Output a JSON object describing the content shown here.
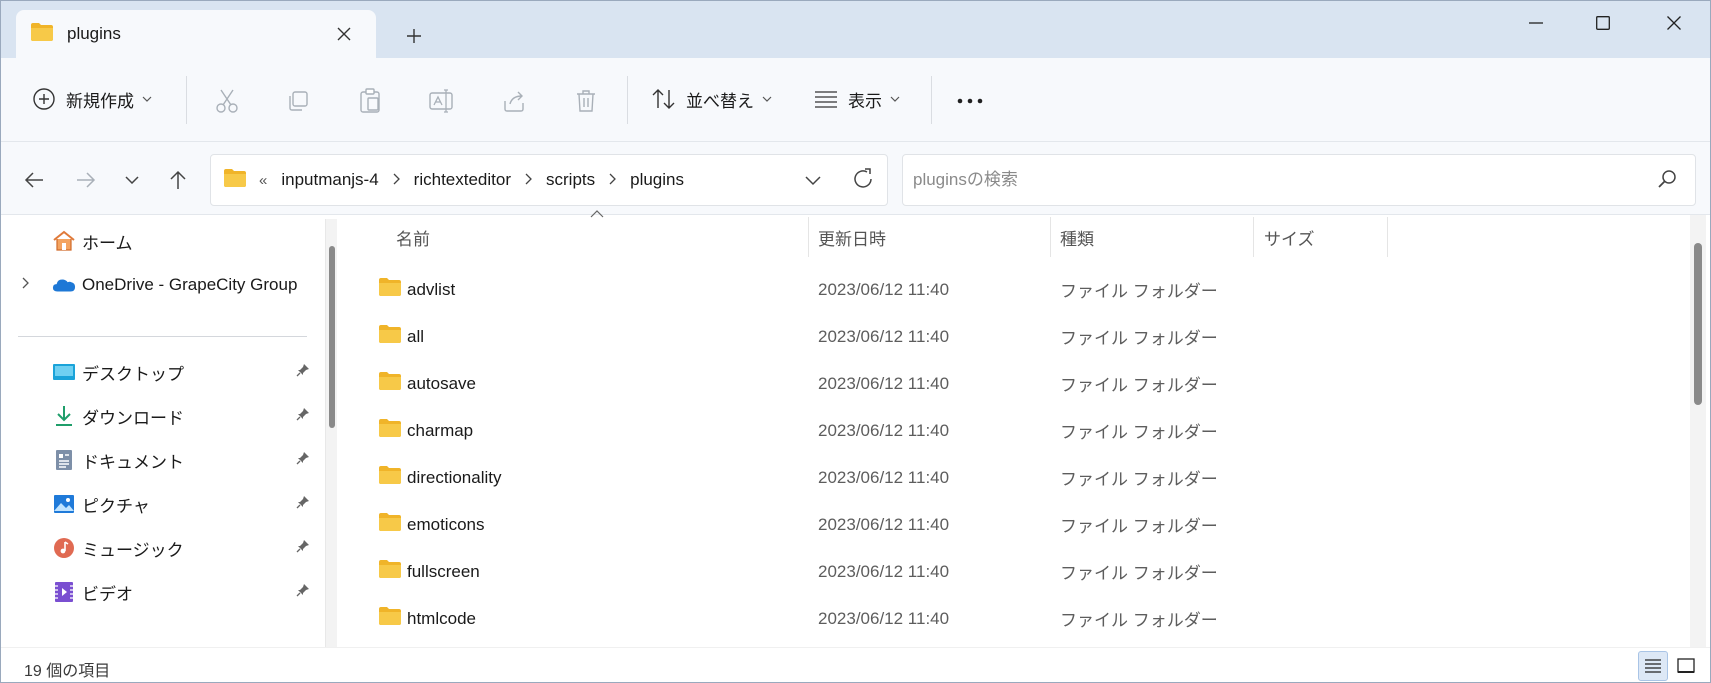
{
  "tab": {
    "title": "plugins",
    "close_icon": "close-icon",
    "new_tab_icon": "plus-icon"
  },
  "window_controls": [
    "minimize-icon",
    "maximize-icon",
    "close-icon"
  ],
  "toolbar": {
    "new_label": "新規作成",
    "sort_label": "並べ替え",
    "view_label": "表示",
    "actions": [
      "cut-icon",
      "copy-icon",
      "paste-icon",
      "rename-icon",
      "share-icon",
      "delete-icon"
    ],
    "more_icon": "more-icon"
  },
  "nav": {
    "breadcrumbs": [
      "inputmanjs-4",
      "richtexteditor",
      "scripts",
      "plugins"
    ],
    "overflow": "«",
    "search_placeholder": "pluginsの検索"
  },
  "sidebar": {
    "items": [
      {
        "label": "ホーム",
        "icon": "home-icon"
      },
      {
        "label": "OneDrive - GrapeCity Group",
        "icon": "cloud-icon"
      },
      {
        "label": "デスクトップ",
        "icon": "desktop-icon",
        "pinned": true
      },
      {
        "label": "ダウンロード",
        "icon": "download-icon",
        "pinned": true
      },
      {
        "label": "ドキュメント",
        "icon": "document-icon",
        "pinned": true
      },
      {
        "label": "ピクチャ",
        "icon": "picture-icon",
        "pinned": true
      },
      {
        "label": "ミュージック",
        "icon": "music-icon",
        "pinned": true
      },
      {
        "label": "ビデオ",
        "icon": "video-icon",
        "pinned": true
      }
    ]
  },
  "columns": {
    "name": "名前",
    "date": "更新日時",
    "type": "種類",
    "size": "サイズ"
  },
  "files": [
    {
      "name": "advlist",
      "date": "2023/06/12 11:40",
      "type": "ファイル フォルダー"
    },
    {
      "name": "all",
      "date": "2023/06/12 11:40",
      "type": "ファイル フォルダー"
    },
    {
      "name": "autosave",
      "date": "2023/06/12 11:40",
      "type": "ファイル フォルダー"
    },
    {
      "name": "charmap",
      "date": "2023/06/12 11:40",
      "type": "ファイル フォルダー"
    },
    {
      "name": "directionality",
      "date": "2023/06/12 11:40",
      "type": "ファイル フォルダー"
    },
    {
      "name": "emoticons",
      "date": "2023/06/12 11:40",
      "type": "ファイル フォルダー"
    },
    {
      "name": "fullscreen",
      "date": "2023/06/12 11:40",
      "type": "ファイル フォルダー"
    },
    {
      "name": "htmlcode",
      "date": "2023/06/12 11:40",
      "type": "ファイル フォルダー"
    }
  ],
  "status": {
    "item_count": "19 個の項目"
  },
  "colors": {
    "titlebar": "#d9e4f1",
    "folder": "#f7c948",
    "accent": "#0067c0"
  }
}
